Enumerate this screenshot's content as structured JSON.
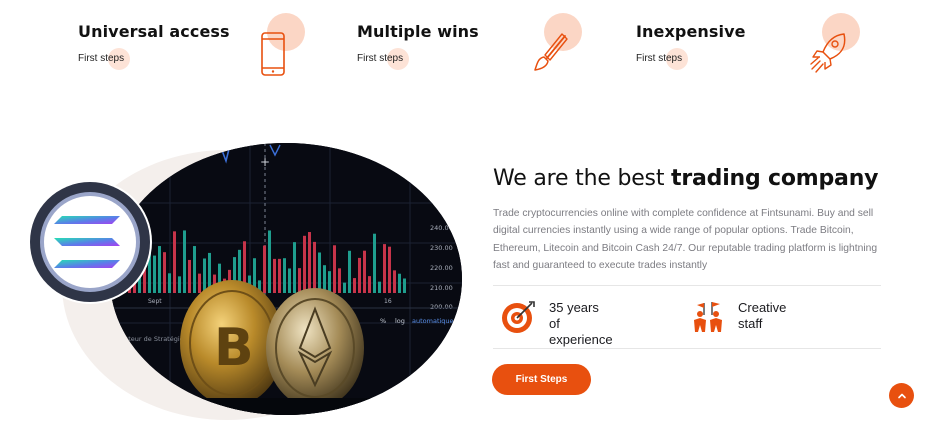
{
  "features": [
    {
      "title": "Universal access",
      "subtitle": "First steps",
      "icon": "smartphone-icon"
    },
    {
      "title": "Multiple wins",
      "subtitle": "First steps",
      "icon": "paintbrush-icon"
    },
    {
      "title": "Inexpensive",
      "subtitle": "First steps",
      "icon": "rocket-icon"
    }
  ],
  "about": {
    "headline_light": "We are the best ",
    "headline_bold": "trading company",
    "paragraph": "Trade cryptocurrencies online with complete confidence at Fintsunami. Buy and sell digital currencies instantly using a wide range of popular options. Trade Bitcoin, Ethereum, Litecoin and Bitcoin Cash 24/7. Our reputable trading platform is lightning fast and guaranteed to execute trades instantly",
    "stats": [
      {
        "line1": "35 years",
        "line2": "of experience",
        "icon": "target-icon"
      },
      {
        "line1": "Creative",
        "line2": "staff",
        "icon": "team-icon"
      }
    ],
    "cta_label": "First Steps"
  },
  "chart_overlay": {
    "price_ticks": [
      "240.00",
      "230.00",
      "220.00",
      "210.00",
      "200.00"
    ],
    "x_ticks": [
      "Sept",
      "16"
    ],
    "toolbar": [
      "%",
      "log",
      "automatique"
    ],
    "panel_label": "Testeur de Stratégie"
  },
  "colors": {
    "accent": "#e8500f",
    "accent_soft": "#fbd6c5"
  },
  "scroll_top_icon": "chevron-up-icon"
}
